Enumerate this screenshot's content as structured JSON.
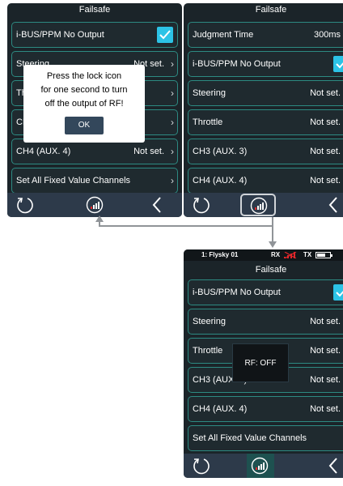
{
  "screen1": {
    "title": "Failsafe",
    "rows": [
      {
        "label": "i-BUS/PPM No Output",
        "checked": true
      },
      {
        "label": "Steering",
        "value": "Not set."
      },
      {
        "label": "Th",
        "value": ""
      },
      {
        "label": "CH",
        "value": ""
      },
      {
        "label": "CH4 (AUX. 4)",
        "value": "Not set."
      },
      {
        "label": "Set All Fixed Value Channels"
      }
    ],
    "dialog": {
      "line1": "Press the lock icon",
      "line2": "for one second to turn",
      "line3": "off the output of RF!",
      "ok_label": "OK"
    }
  },
  "screen2": {
    "title": "Failsafe",
    "rows": [
      {
        "label": "Judgment Time",
        "value": "300ms"
      },
      {
        "label": "i-BUS/PPM No Output",
        "checked": true
      },
      {
        "label": "Steering",
        "value": "Not set."
      },
      {
        "label": "Throttle",
        "value": "Not set."
      },
      {
        "label": "CH3 (AUX. 3)",
        "value": "Not set."
      },
      {
        "label": "CH4 (AUX. 4)",
        "value": "Not set."
      }
    ]
  },
  "screen3": {
    "status": {
      "model": "1: Flysky 01",
      "rx_label": "RX",
      "tx_label": "TX"
    },
    "title": "Failsafe",
    "rows": [
      {
        "label": "i-BUS/PPM No Output",
        "checked": true
      },
      {
        "label": "Steering",
        "value": "Not set."
      },
      {
        "label": "Throttle",
        "value": "Not set."
      },
      {
        "label": "CH3 (AUX. 3)",
        "value": "Not set."
      },
      {
        "label": "CH4 (AUX. 4)",
        "value": "Not set."
      },
      {
        "label": "Set All Fixed Value Channels"
      }
    ],
    "toast": "RF: OFF"
  },
  "icons": {
    "back": "back-circle-icon",
    "rf_signal": "rf-signal-icon",
    "previous": "chevron-left-icon",
    "check": "checkmark-icon",
    "chevron": "chevron-right-icon"
  },
  "colors": {
    "screen_bg": "#1b2429",
    "row_border": "#2d8a82",
    "checkbox": "#2cc3e6",
    "navbar": "#2d3a4a",
    "rf_icon_accent": "#e0262a",
    "selected_nav": "#1e5150"
  }
}
